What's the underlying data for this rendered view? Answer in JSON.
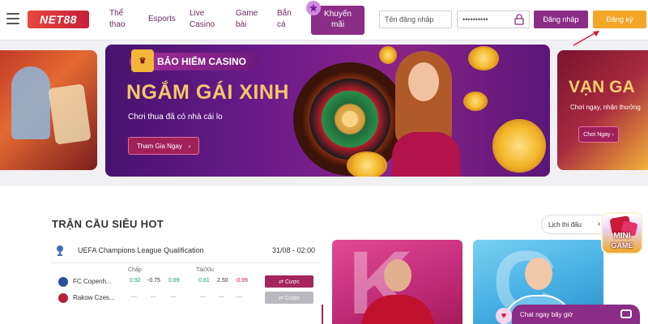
{
  "header": {
    "logo_text": "NET88",
    "nav": [
      {
        "line1": "Thể",
        "line2": "thao"
      },
      {
        "line1": "Esports",
        "line2": ""
      },
      {
        "line1": "Live",
        "line2": "Casino"
      },
      {
        "line1": "Game",
        "line2": "bài"
      },
      {
        "line1": "Bắn",
        "line2": "cá"
      }
    ],
    "promo": {
      "line1": "Khuyến",
      "line2": "mãi"
    },
    "username_placeholder": "Tên đăng nhập",
    "password_value": "••••••••••",
    "login_label": "Đăng nhập",
    "register_label": "Đăng ký"
  },
  "banners": {
    "main": {
      "tag": "BẢO HIỂM CASINO",
      "title": "NGẮM GÁI XINH",
      "subtitle": "Chơi thua đã có nhà cái lo",
      "button": "Tham Gia Ngay",
      "button_arrow": "›"
    },
    "right": {
      "title": "VẠN GA",
      "subtitle": "Chơi ngay, nhận thưởng",
      "button": "Chơi Ngay ›"
    }
  },
  "hot_matches": {
    "title": "TRẬN CẦU SIÊU HOT",
    "schedule_label": "Lịch thi đấu",
    "schedule_arrow": "›",
    "league": "UEFA Champions League Qualification",
    "time": "31/08 - 02:00",
    "col_handicap": "Chấp",
    "col_overunder": "Tài/Xỉu",
    "rows": [
      {
        "team": "FC Copenh...",
        "o1": "0.92",
        "o2": "-0.75",
        "o3": "0.89",
        "o4": "0.81",
        "o5": "2.50",
        "o6": "-0.99",
        "bet": "⇄ Cược"
      },
      {
        "team": "Rakow Czes...",
        "o1": "—",
        "o2": "—",
        "o3": "—",
        "o4": "—",
        "o5": "—",
        "o6": "—",
        "bet": "⇄ Cược"
      }
    ]
  },
  "player_cards": [
    {
      "letter": "K"
    },
    {
      "letter": "C"
    }
  ],
  "mini_game": {
    "line1": "MINI",
    "line2": "GAME"
  },
  "chat": {
    "label": "Chat ngay bây giờ",
    "heart": "♥"
  },
  "colors": {
    "brand_purple": "#8b2d86",
    "register_orange": "#f4a629",
    "odds_green": "#1f9d55",
    "odds_red": "#d6173f"
  }
}
